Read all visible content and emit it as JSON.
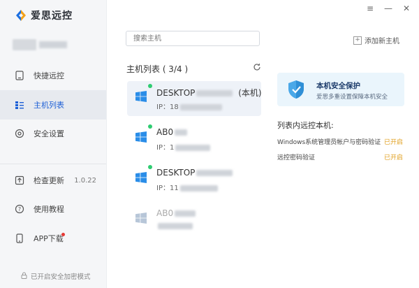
{
  "app": {
    "title": "爱思远控"
  },
  "nav": {
    "quick": "快捷远控",
    "hosts": "主机列表",
    "security": "安全设置",
    "update": "检查更新",
    "version": "1.0.22",
    "tutorial": "使用教程",
    "app_download": "APP下载",
    "footer": "已开启安全加密模式"
  },
  "window": {
    "menu": "≡",
    "minimize": "—",
    "close": "✕"
  },
  "search": {
    "placeholder": "搜索主机"
  },
  "toolbar": {
    "add_host": "添加新主机",
    "add_glyph": "+"
  },
  "hosts": {
    "title": "主机列表 ( 3/4 )",
    "items": [
      {
        "name": "DESKTOP",
        "suffix": "(本机)",
        "ip": "IP：18"
      },
      {
        "name": "AB0",
        "suffix": "",
        "ip": "IP：1"
      },
      {
        "name": "DESKTOP",
        "suffix": "",
        "ip": "IP：11"
      },
      {
        "name": "AB0",
        "suffix": "",
        "ip": ""
      }
    ]
  },
  "security": {
    "banner_title": "本机安全保护",
    "banner_sub": "爱思多重设置保障本机安全",
    "list_title": "列表内远控本机:",
    "rows": [
      {
        "label": "Windows系统管理员帐户与密码验证",
        "status": "已开启"
      },
      {
        "label": "远控密码验证",
        "status": "已开启"
      }
    ]
  },
  "colors": {
    "accent": "#1c5fd6",
    "online": "#2ecc71",
    "status_on": "#e0a020"
  }
}
